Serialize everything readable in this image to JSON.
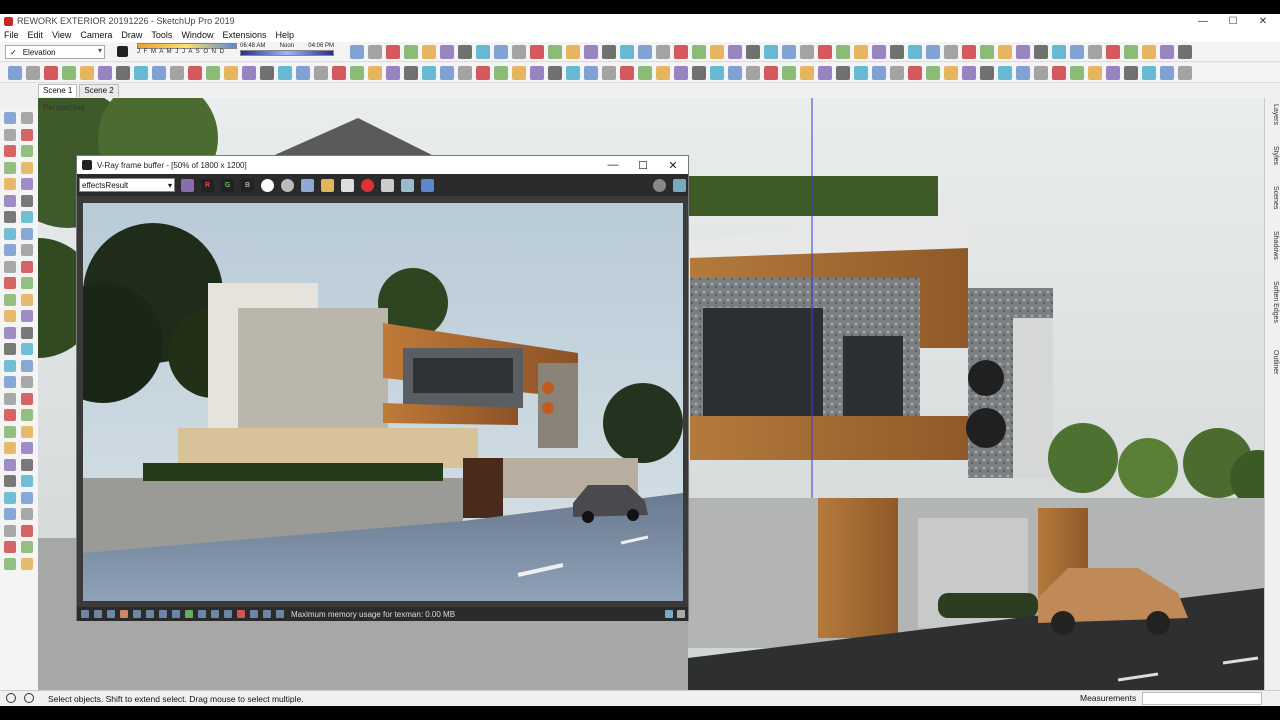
{
  "window": {
    "title": "REWORK EXTERIOR 20191226 - SketchUp Pro 2019",
    "minimize": "—",
    "maximize": "☐",
    "close": "✕"
  },
  "menu": [
    "File",
    "Edit",
    "View",
    "Camera",
    "Draw",
    "Tools",
    "Window",
    "Extensions",
    "Help"
  ],
  "toolbar": {
    "style_select": "Elevation",
    "style_check": "✓",
    "months": "J F M A M J J A S O N D",
    "time_start": "06:48 AM",
    "time_noon": "Noon",
    "time_end": "04:06 PM"
  },
  "scenes": [
    "Scene 1",
    "Scene 2"
  ],
  "viewport_label": "Perspective",
  "right_dock": [
    "Layers",
    "Styles",
    "Scenes",
    "Shadows",
    "Soften Edges",
    "Outliner"
  ],
  "status": {
    "message": "Select objects. Shift to extend select. Drag mouse to select multiple.",
    "measurements_label": "Measurements"
  },
  "vray": {
    "title": "V-Ray frame buffer - [50% of 1800 x 1200]",
    "channel": "effectsResult",
    "btn_r": "R",
    "btn_g": "G",
    "btn_b": "B",
    "status_message": "Maximum memory usage for texman: 0.00 MB"
  },
  "colors": {
    "accent_red": "#c8262a",
    "sky": "#c6d4df",
    "wood": "#9a6230",
    "concrete": "#8c8f90"
  }
}
